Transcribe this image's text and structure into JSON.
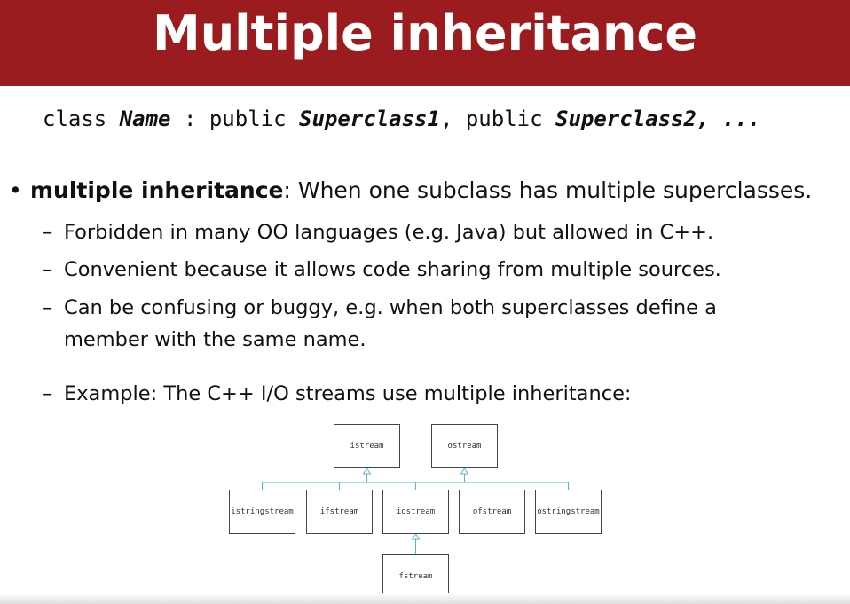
{
  "slide": {
    "title": "Multiple inheritance",
    "code": {
      "kw_class": "class ",
      "name": "Name",
      "sep1": " : public ",
      "super1": "Superclass1",
      "sep2": ", public ",
      "super2": "Superclass2",
      "tail": ", ..."
    },
    "bullet": {
      "term": "multiple inheritance",
      "text": ": When one subclass has multiple superclasses."
    },
    "sub_items": [
      "Forbidden in many OO languages (e.g. Java) but allowed in C++.",
      "Convenient because it allows code sharing from multiple sources.",
      "Can be confusing or buggy, e.g. when both superclasses define a member with the same name.",
      "Example: The C++ I/O streams use multiple inheritance:"
    ],
    "diagram": {
      "nodes": {
        "istream": "istream",
        "ostream": "ostream",
        "istringstream": "istringstream",
        "ifstream": "ifstream",
        "iostream": "iostream",
        "ofstream": "ofstream",
        "ostringstream": "ostringstream",
        "fstream": "fstream"
      },
      "edges": [
        [
          "istringstream",
          "istream"
        ],
        [
          "ifstream",
          "istream"
        ],
        [
          "iostream",
          "istream"
        ],
        [
          "iostream",
          "ostream"
        ],
        [
          "ofstream",
          "ostream"
        ],
        [
          "ostringstream",
          "ostream"
        ],
        [
          "fstream",
          "iostream"
        ]
      ],
      "edge_color": "#5ab4d6"
    }
  }
}
